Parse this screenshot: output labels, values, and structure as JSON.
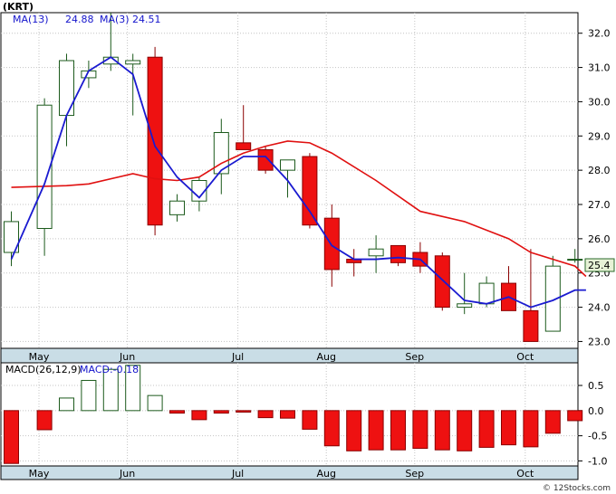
{
  "chart_data": [
    {
      "type": "candlestick",
      "panel": "price",
      "symbol": "(KRT)",
      "ma13_label": "MA(13)",
      "ma13_value": "24.88",
      "ma3_label": "MA(3)",
      "ma3_value": "24.51",
      "last_price_label": "25.4",
      "ylim": [
        22.8,
        32.6
      ],
      "yticks": [
        "23.0",
        "24.0",
        "25.0",
        "26.0",
        "27.0",
        "28.0",
        "29.0",
        "30.0",
        "31.0",
        "32.0"
      ],
      "months": [
        "May",
        "Jun",
        "Jul",
        "Aug",
        "Sep",
        "Oct"
      ],
      "month_positions": [
        2.5,
        10.5,
        20.5,
        28.5,
        36.5,
        46.5
      ],
      "candles": [
        {
          "o": 25.6,
          "h": 26.8,
          "l": 25.2,
          "c": 26.5
        },
        {
          "o": 26.3,
          "h": 30.1,
          "l": 25.5,
          "c": 29.9
        },
        {
          "o": 29.6,
          "h": 31.4,
          "l": 28.7,
          "c": 31.2
        },
        {
          "o": 30.7,
          "h": 31.2,
          "l": 30.4,
          "c": 30.9
        },
        {
          "o": 31.1,
          "h": 32.6,
          "l": 30.9,
          "c": 31.3
        },
        {
          "o": 31.1,
          "h": 31.4,
          "l": 29.6,
          "c": 31.2
        },
        {
          "o": 31.3,
          "h": 31.6,
          "l": 26.1,
          "c": 26.4
        },
        {
          "o": 26.7,
          "h": 27.3,
          "l": 26.5,
          "c": 27.1
        },
        {
          "o": 27.1,
          "h": 27.8,
          "l": 26.8,
          "c": 27.7
        },
        {
          "o": 27.9,
          "h": 29.5,
          "l": 27.3,
          "c": 29.1
        },
        {
          "o": 28.8,
          "h": 29.9,
          "l": 28.6,
          "c": 28.6
        },
        {
          "o": 28.6,
          "h": 28.7,
          "l": 27.9,
          "c": 28.0
        },
        {
          "o": 28.0,
          "h": 28.2,
          "l": 27.2,
          "c": 28.3
        },
        {
          "o": 28.4,
          "h": 28.5,
          "l": 26.3,
          "c": 26.4
        },
        {
          "o": 26.6,
          "h": 27.0,
          "l": 24.6,
          "c": 25.1
        },
        {
          "o": 25.4,
          "h": 25.7,
          "l": 24.9,
          "c": 25.3
        },
        {
          "o": 25.5,
          "h": 26.1,
          "l": 25.0,
          "c": 25.7
        },
        {
          "o": 25.8,
          "h": 25.8,
          "l": 25.2,
          "c": 25.3
        },
        {
          "o": 25.6,
          "h": 25.9,
          "l": 25.0,
          "c": 25.2
        },
        {
          "o": 25.5,
          "h": 25.6,
          "l": 23.9,
          "c": 24.0
        },
        {
          "o": 24.0,
          "h": 25.0,
          "l": 23.8,
          "c": 24.1
        },
        {
          "o": 24.1,
          "h": 24.9,
          "l": 24.0,
          "c": 24.7
        },
        {
          "o": 24.7,
          "h": 25.2,
          "l": 23.9,
          "c": 23.9
        },
        {
          "o": 23.9,
          "h": 25.7,
          "l": 23.0,
          "c": 23.0
        },
        {
          "o": 23.3,
          "h": 25.5,
          "l": 23.3,
          "c": 25.2
        },
        {
          "o": 25.4,
          "h": 25.7,
          "l": 25.3,
          "c": 25.4
        }
      ],
      "candle_positions": [
        0,
        3,
        5,
        7,
        9,
        11,
        13,
        15,
        17,
        19,
        21,
        23,
        25,
        27,
        29,
        31,
        33,
        35,
        37,
        39,
        41,
        43,
        45,
        47,
        49,
        51
      ],
      "ma13": [
        [
          0,
          27.5
        ],
        [
          5,
          27.55
        ],
        [
          7,
          27.6
        ],
        [
          11,
          27.9
        ],
        [
          13,
          27.75
        ],
        [
          15,
          27.7
        ],
        [
          17,
          27.8
        ],
        [
          19,
          28.2
        ],
        [
          21,
          28.5
        ],
        [
          23,
          28.7
        ],
        [
          25,
          28.85
        ],
        [
          27,
          28.8
        ],
        [
          29,
          28.5
        ],
        [
          33,
          27.7
        ],
        [
          37,
          26.8
        ],
        [
          41,
          26.5
        ],
        [
          45,
          26.0
        ],
        [
          47,
          25.6
        ],
        [
          51,
          25.2
        ],
        [
          52,
          24.9
        ]
      ],
      "ma3": [
        [
          0,
          25.4
        ],
        [
          3,
          27.6
        ],
        [
          5,
          29.6
        ],
        [
          7,
          30.9
        ],
        [
          9,
          31.3
        ],
        [
          11,
          30.8
        ],
        [
          13,
          28.7
        ],
        [
          15,
          27.8
        ],
        [
          17,
          27.2
        ],
        [
          19,
          28.0
        ],
        [
          21,
          28.4
        ],
        [
          23,
          28.4
        ],
        [
          25,
          27.7
        ],
        [
          27,
          26.8
        ],
        [
          29,
          25.8
        ],
        [
          31,
          25.4
        ],
        [
          33,
          25.4
        ],
        [
          35,
          25.45
        ],
        [
          37,
          25.4
        ],
        [
          39,
          24.8
        ],
        [
          41,
          24.2
        ],
        [
          43,
          24.1
        ],
        [
          45,
          24.3
        ],
        [
          47,
          24.0
        ],
        [
          49,
          24.2
        ],
        [
          51,
          24.5
        ],
        [
          52,
          24.5
        ]
      ]
    },
    {
      "type": "bar",
      "panel": "macd",
      "label": "MACD(26,12,9)",
      "value_label": "MACD:-0.18",
      "ylim": [
        -1.1,
        0.95
      ],
      "yticks": [
        "0.5",
        "0.0",
        "-0.5",
        "-1.0"
      ],
      "bars": [
        [
          0,
          -1.05
        ],
        [
          3,
          -0.38
        ],
        [
          5,
          0.25
        ],
        [
          7,
          0.6
        ],
        [
          9,
          0.82
        ],
        [
          11,
          0.9
        ],
        [
          13,
          0.3
        ],
        [
          15,
          -0.05
        ],
        [
          17,
          -0.18
        ],
        [
          19,
          -0.05
        ],
        [
          21,
          -0.03
        ],
        [
          23,
          -0.14
        ],
        [
          25,
          -0.15
        ],
        [
          27,
          -0.37
        ],
        [
          29,
          -0.7
        ],
        [
          31,
          -0.8
        ],
        [
          33,
          -0.78
        ],
        [
          35,
          -0.78
        ],
        [
          37,
          -0.75
        ],
        [
          39,
          -0.78
        ],
        [
          41,
          -0.8
        ],
        [
          43,
          -0.73
        ],
        [
          45,
          -0.68
        ],
        [
          47,
          -0.72
        ],
        [
          49,
          -0.45
        ],
        [
          51,
          -0.2
        ]
      ],
      "months": [
        "May",
        "Jun",
        "Jul",
        "Aug",
        "Sep",
        "Oct"
      ],
      "month_positions": [
        2.5,
        10.5,
        20.5,
        28.5,
        36.5,
        46.5
      ]
    }
  ],
  "footer": "© 12Stocks.com"
}
